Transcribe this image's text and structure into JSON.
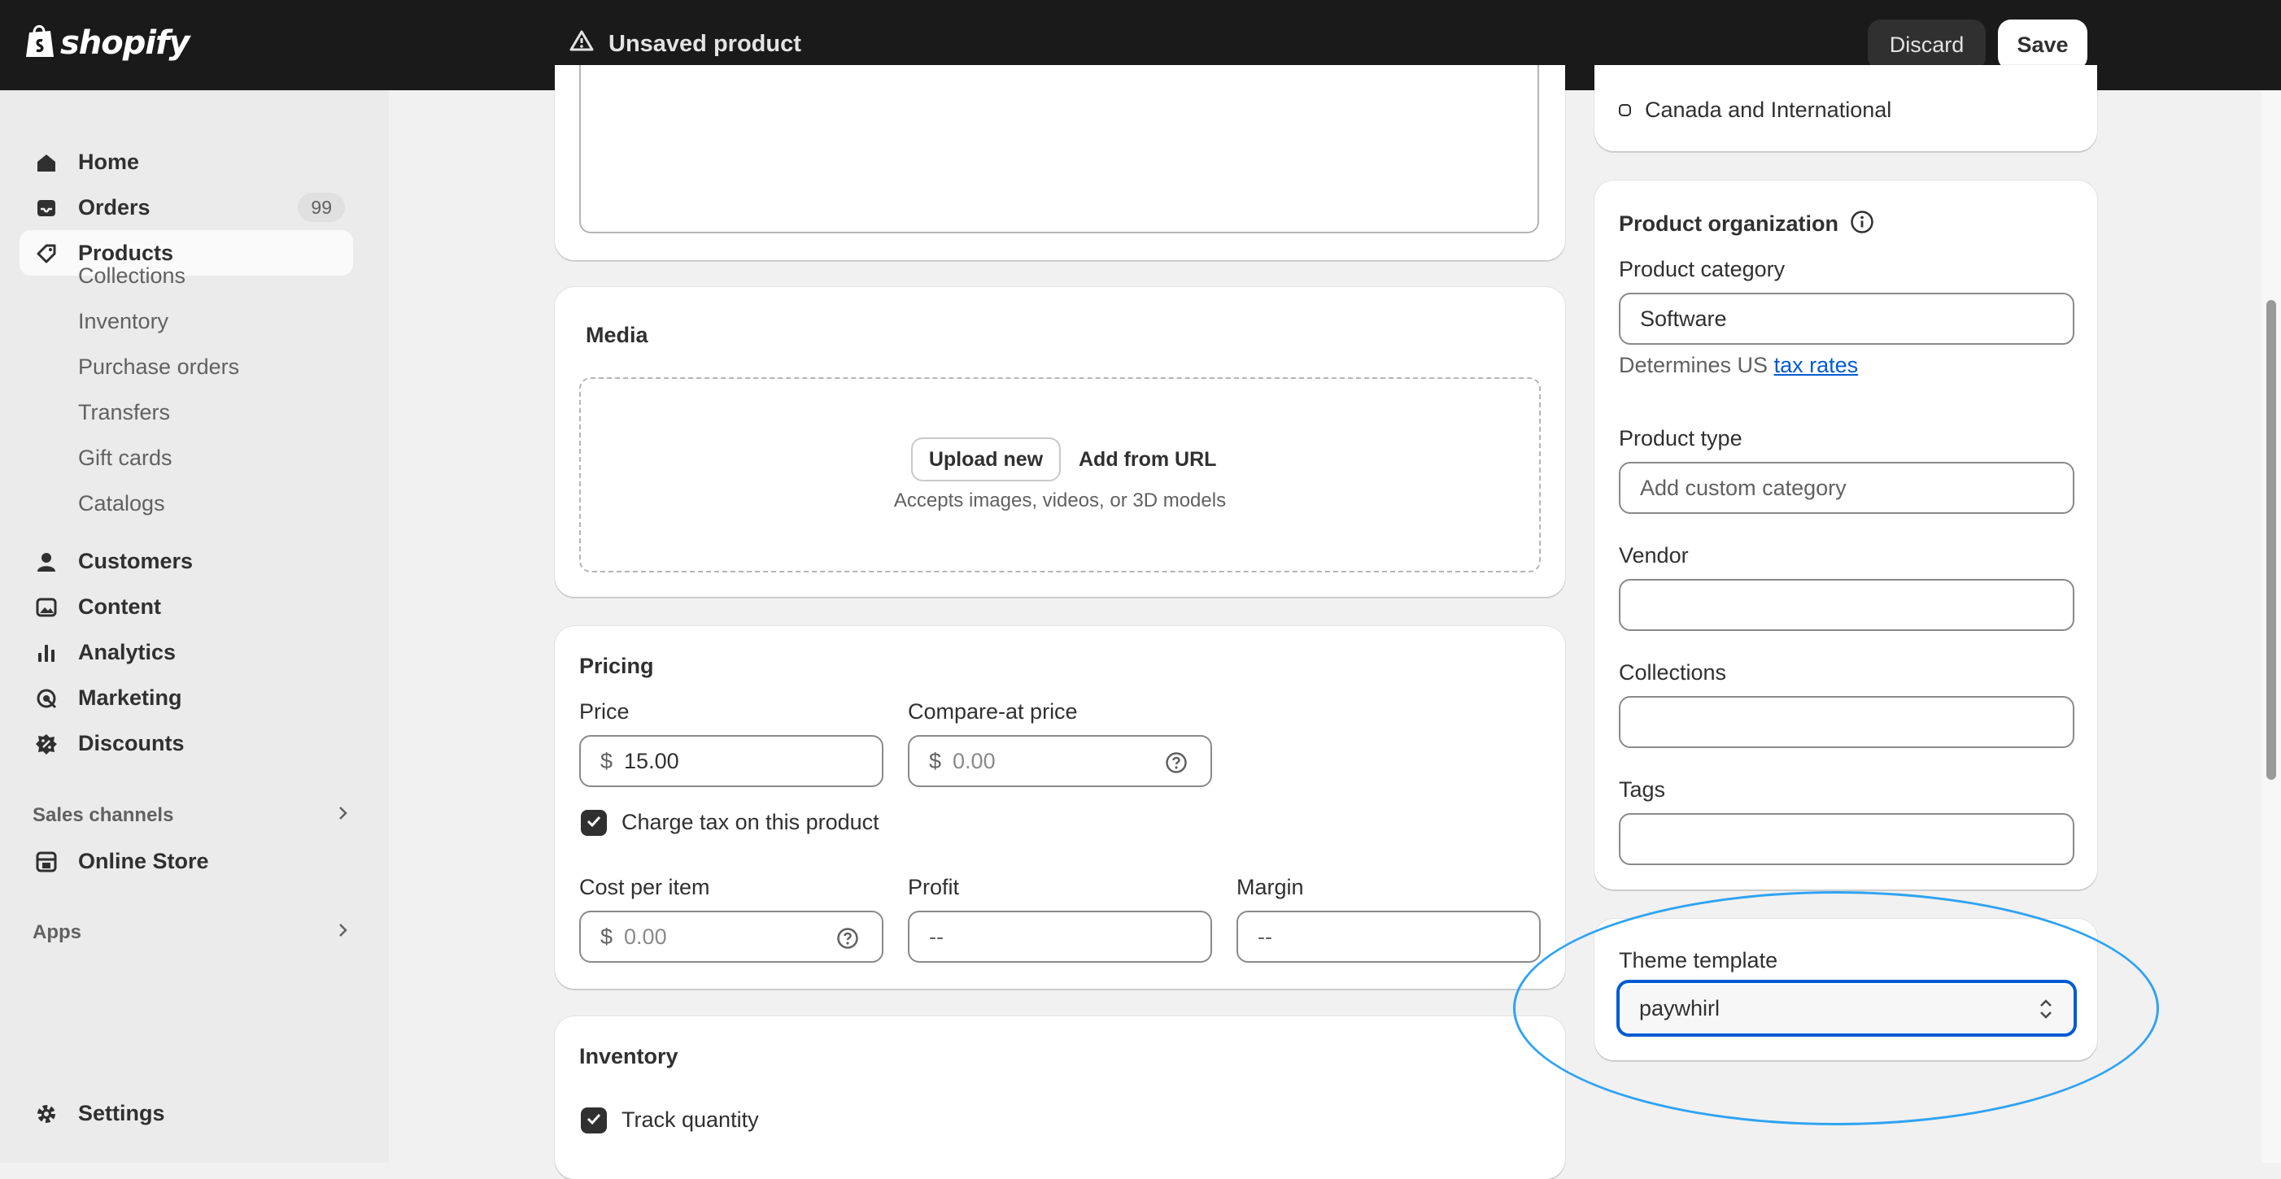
{
  "topbar": {
    "brand": "shopify",
    "status": "Unsaved product",
    "discard": "Discard",
    "save": "Save"
  },
  "sidebar": {
    "items": [
      {
        "label": "Home",
        "icon": "home-icon"
      },
      {
        "label": "Orders",
        "icon": "inbox-icon",
        "badge": "99"
      },
      {
        "label": "Products",
        "icon": "tag-icon"
      }
    ],
    "product_subitems": [
      "Collections",
      "Inventory",
      "Purchase orders",
      "Transfers",
      "Gift cards",
      "Catalogs"
    ],
    "items2": [
      {
        "label": "Customers",
        "icon": "person-icon"
      },
      {
        "label": "Content",
        "icon": "image-icon"
      },
      {
        "label": "Analytics",
        "icon": "bar-chart-icon"
      },
      {
        "label": "Marketing",
        "icon": "target-icon"
      },
      {
        "label": "Discounts",
        "icon": "discount-badge-icon"
      }
    ],
    "sales_channels": "Sales channels",
    "online_store": "Online Store",
    "apps": "Apps",
    "settings": "Settings"
  },
  "markets": {
    "option": "Canada and International"
  },
  "media": {
    "title": "Media",
    "upload": "Upload new",
    "add_url": "Add from URL",
    "hint": "Accepts images, videos, or 3D models"
  },
  "pricing": {
    "title": "Pricing",
    "price_label": "Price",
    "currency": "$",
    "price": "15.00",
    "compare_label": "Compare-at price",
    "compare_placeholder": "0.00",
    "charge_tax": "Charge tax on this product",
    "cost_label": "Cost per item",
    "cost_placeholder": "0.00",
    "profit_label": "Profit",
    "profit": "--",
    "margin_label": "Margin",
    "margin": "--"
  },
  "inventory": {
    "title": "Inventory",
    "track": "Track quantity"
  },
  "organization": {
    "title": "Product organization",
    "category_label": "Product category",
    "category": "Software",
    "category_hint": "Determines US ",
    "tax_link": "tax rates",
    "type_label": "Product type",
    "type_placeholder": "Add custom category",
    "vendor_label": "Vendor",
    "collections_label": "Collections",
    "tags_label": "Tags"
  },
  "theme": {
    "label": "Theme template",
    "value": "paywhirl"
  },
  "colors": {
    "topbar": "#1a1a1a",
    "link": "#005bd3",
    "annotation": "#2ea3f2",
    "focus": "#005bd3"
  }
}
